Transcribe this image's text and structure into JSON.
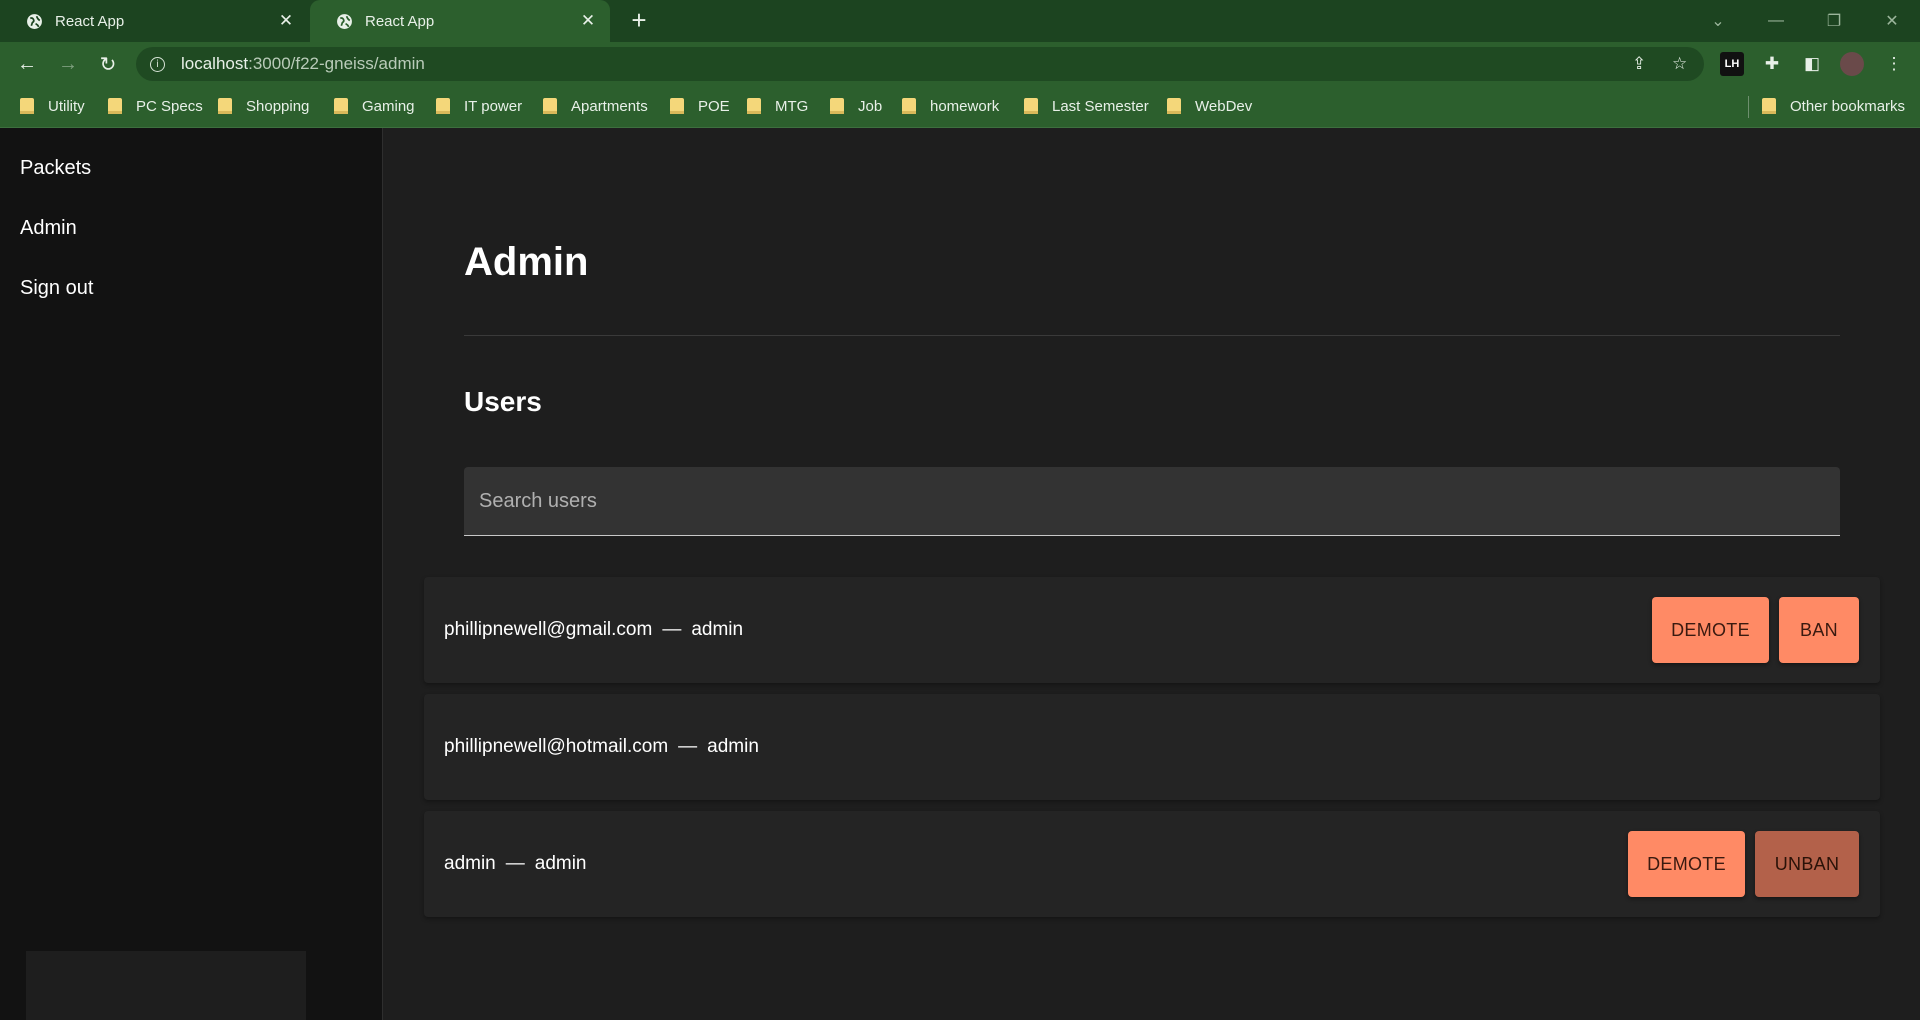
{
  "browser": {
    "tabs": [
      {
        "title": "React App",
        "active": false
      },
      {
        "title": "React App",
        "active": true
      }
    ],
    "url_host": "localhost",
    "url_path": ":3000/f22-gneiss/admin",
    "bookmarks": [
      "Utility",
      "PC Specs",
      "Shopping",
      "Gaming",
      "IT power",
      "Apartments",
      "POE",
      "MTG",
      "Job",
      "homework",
      "Last Semester",
      "WebDev"
    ],
    "other_bookmarks": "Other bookmarks",
    "extension_badge": "LH"
  },
  "sidebar": {
    "items": [
      {
        "label": "Packets"
      },
      {
        "label": "Admin"
      },
      {
        "label": "Sign out"
      }
    ]
  },
  "main": {
    "title": "Admin",
    "section_title": "Users",
    "search": {
      "placeholder": "Search users",
      "value": ""
    },
    "separator": "—",
    "users": [
      {
        "email": "phillipnewell@gmail.com",
        "role": "admin",
        "buttons": [
          "DEMOTE",
          "BAN"
        ]
      },
      {
        "email": "phillipnewell@hotmail.com",
        "role": "admin",
        "buttons": []
      },
      {
        "email": "admin",
        "role": "admin",
        "buttons": [
          "DEMOTE",
          "UNBAN"
        ]
      }
    ]
  },
  "colors": {
    "tab_strip": "#1c4420",
    "toolbar": "#2c5f2d",
    "accent_button": "#ff8a65",
    "muted_button": "#b3614a"
  }
}
